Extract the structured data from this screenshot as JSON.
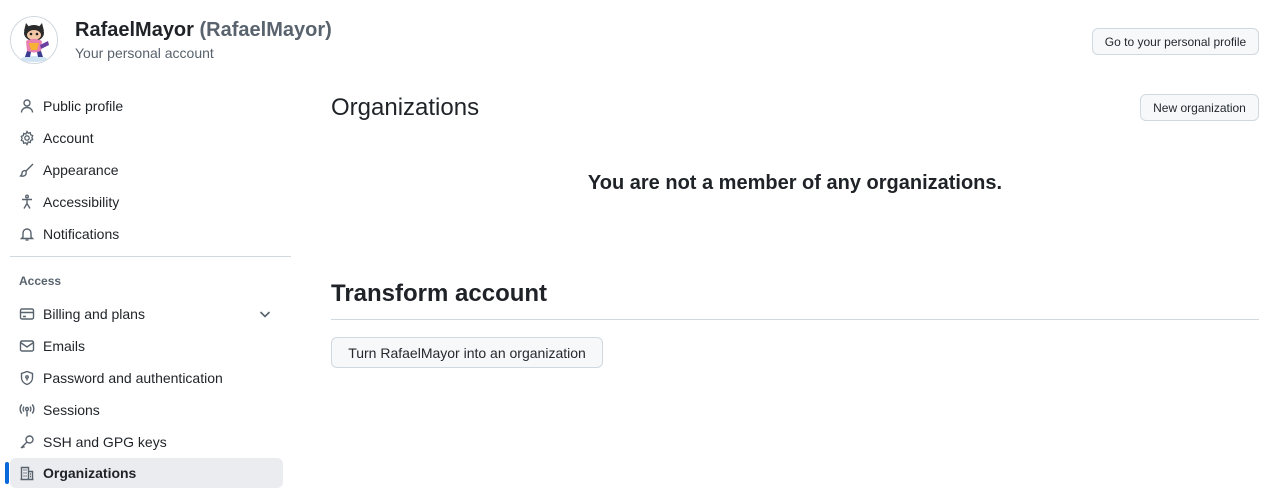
{
  "header": {
    "display_name": "RafaelMayor",
    "handle": "(RafaelMayor)",
    "subtitle": "Your personal account",
    "profile_button": "Go to your personal profile",
    "avatar_icon": "octocat-avatar-icon"
  },
  "sidebar": {
    "items_top": [
      {
        "label": "Public profile",
        "icon": "person-icon"
      },
      {
        "label": "Account",
        "icon": "gear-icon"
      },
      {
        "label": "Appearance",
        "icon": "paintbrush-icon"
      },
      {
        "label": "Accessibility",
        "icon": "accessibility-icon"
      },
      {
        "label": "Notifications",
        "icon": "bell-icon"
      }
    ],
    "access_label": "Access",
    "items_access": [
      {
        "label": "Billing and plans",
        "icon": "credit-card-icon",
        "expandable": true
      },
      {
        "label": "Emails",
        "icon": "mail-icon"
      },
      {
        "label": "Password and authentication",
        "icon": "shield-lock-icon"
      },
      {
        "label": "Sessions",
        "icon": "broadcast-icon"
      },
      {
        "label": "SSH and GPG keys",
        "icon": "key-icon"
      },
      {
        "label": "Organizations",
        "icon": "organization-icon",
        "selected": true
      }
    ],
    "accent_color": "#0969da"
  },
  "main": {
    "title": "Organizations",
    "new_org_button": "New organization",
    "empty_message": "You are not a member of any organizations.",
    "transform_title": "Transform account",
    "transform_button": "Turn RafaelMayor into an organization"
  }
}
